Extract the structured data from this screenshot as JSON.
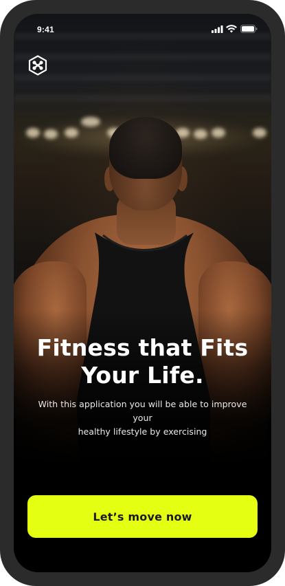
{
  "status_bar": {
    "time": "9:41",
    "icons": [
      "cellular-signal-icon",
      "wifi-icon",
      "battery-icon"
    ]
  },
  "brand": {
    "logo_icon": "app-logo-icon",
    "accent_color": "#e5ff13"
  },
  "hero": {
    "title_line1": "Fitness that Fits",
    "title_line2": "Your Life.",
    "subtitle_line1": "With this application you will be able to improve your",
    "subtitle_line2": "healthy lifestyle by exercising"
  },
  "cta": {
    "label": "Let’s move now"
  },
  "colors": {
    "device_frame": "#2b2b2b",
    "screen_bg": "#0f0f10",
    "cta_bg": "#e5ff13",
    "text_primary": "#ffffff",
    "cta_text": "#1a1a1a"
  }
}
